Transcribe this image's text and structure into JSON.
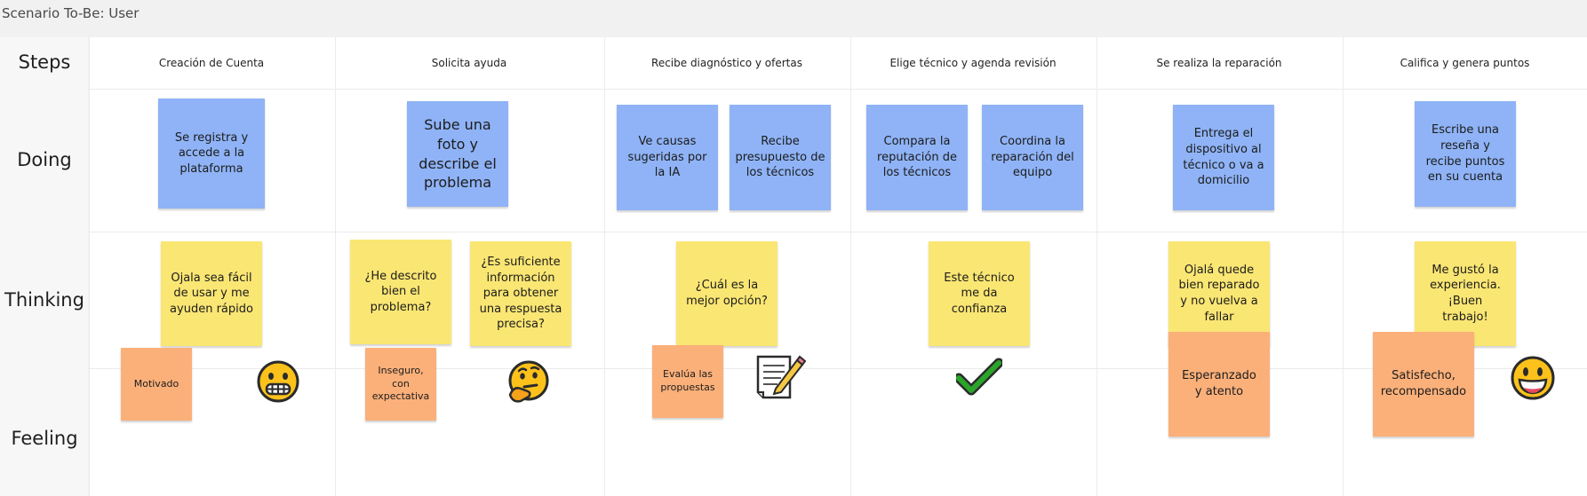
{
  "title": "Scenario To-Be: User",
  "row_labels": {
    "steps": "Steps",
    "doing": "Doing",
    "thinking": "Thinking",
    "feeling": "Feeling"
  },
  "steps": [
    "Creación de Cuenta",
    "Solicita ayuda",
    "Recibe diagnóstico y ofertas",
    "Elige técnico y agenda revisión",
    "Se realiza la reparación",
    "Califica y genera puntos"
  ],
  "doing": {
    "c1": "Se registra y accede a la plataforma",
    "c2": "Sube una foto y describe el problema",
    "c3a": "Ve causas sugeridas por la IA",
    "c3b": "Recibe presupuesto de los técnicos",
    "c4a": "Compara la reputación de los técnicos",
    "c4b": "Coordina la reparación del equipo",
    "c5": "Entrega el dispositivo al técnico o va a domicilio",
    "c6": "Escribe una reseña y recibe puntos en su cuenta"
  },
  "thinking": {
    "c1": "Ojala sea fácil de usar y me ayuden rápido",
    "c2a": "¿He descrito bien el problema?",
    "c2b": "¿Es suficiente información para obtener una respuesta precisa?",
    "c3": "¿Cuál es la mejor opción?",
    "c4": "Este técnico me da confianza",
    "c5": "Ojalá quede bien reparado y no vuelva a fallar",
    "c6": "Me gustó la experiencia. ¡Buen trabajo!"
  },
  "feeling": {
    "c1": "Motivado",
    "c2": "Inseguro, con expectativa",
    "c3": "Evalúa las propuestas",
    "c5": "Esperanzado y atento",
    "c6": "Satisfecho, recompensado"
  },
  "icons": {
    "c1": "grimacing-face-icon",
    "c2": "thinking-face-icon",
    "c3": "memo-icon",
    "c4": "check-mark-icon",
    "c6": "grinning-face-icon"
  },
  "colors": {
    "doing_note": "#8fb3f6",
    "thinking_note": "#fae673",
    "feeling_note": "#fbb07a",
    "check": "#2aa52a"
  }
}
